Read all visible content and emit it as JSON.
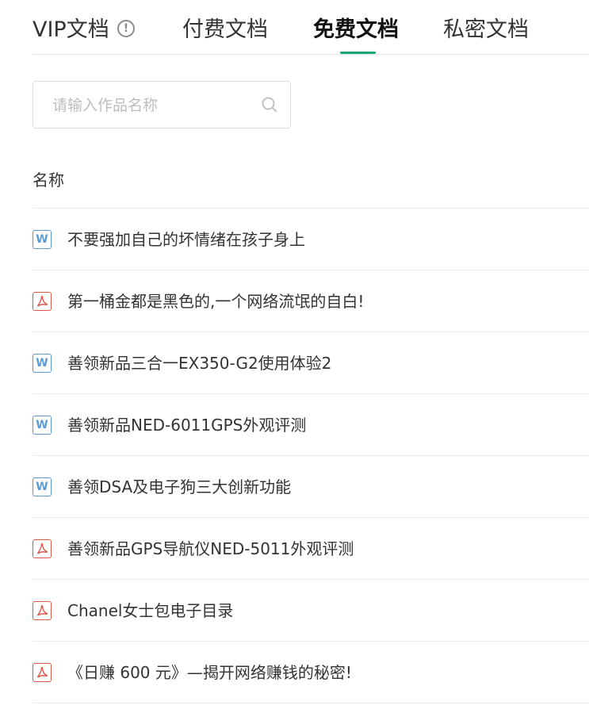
{
  "tabs": [
    {
      "label": "VIP文档",
      "active": false
    },
    {
      "label": "付费文档",
      "active": false
    },
    {
      "label": "免费文档",
      "active": true
    },
    {
      "label": "私密文档",
      "active": false
    }
  ],
  "tabs_info_icon": "info-circle-icon",
  "accent_color": "#18a57a",
  "search": {
    "placeholder": "请输入作品名称",
    "value": "",
    "icon": "search-icon"
  },
  "table": {
    "column_header": "名称"
  },
  "documents": [
    {
      "type": "word",
      "title": "不要强加自己的坏情绪在孩子身上"
    },
    {
      "type": "pdf",
      "title": "第一桶金都是黑色的,一个网络流氓的自白!"
    },
    {
      "type": "word",
      "title": "善领新品三合一EX350-G2使用体验2"
    },
    {
      "type": "word",
      "title": "善领新品NED-6011GPS外观评测"
    },
    {
      "type": "word",
      "title": "善领DSA及电子狗三大创新功能"
    },
    {
      "type": "pdf",
      "title": "善领新品GPS导航仪NED-5011外观评测"
    },
    {
      "type": "pdf",
      "title": "Chanel女士包电子目录"
    },
    {
      "type": "pdf",
      "title": "《日赚 600 元》—揭开网络赚钱的秘密!"
    }
  ],
  "file_icons": {
    "word": "word-file-icon",
    "pdf": "pdf-file-icon",
    "word_glyph": "W"
  }
}
